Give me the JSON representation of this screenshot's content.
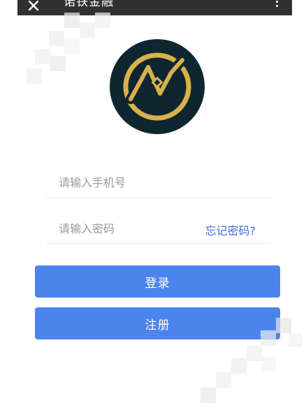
{
  "header": {
    "title": "诺铁金融"
  },
  "form": {
    "phone_placeholder": "请输入手机号",
    "password_placeholder": "请输入密码",
    "forgot_label": "忘记密码?"
  },
  "buttons": {
    "login_label": "登录",
    "register_label": "注册"
  },
  "colors": {
    "primary": "#4c84ee",
    "link": "#3f6fd6",
    "topbar": "#303030",
    "logo_bg": "#0f2630",
    "logo_gold": "#d9b04a"
  },
  "icons": {
    "back": "close-x-icon",
    "more": "more-vertical-icon",
    "logo": "gold-ring-logo"
  }
}
